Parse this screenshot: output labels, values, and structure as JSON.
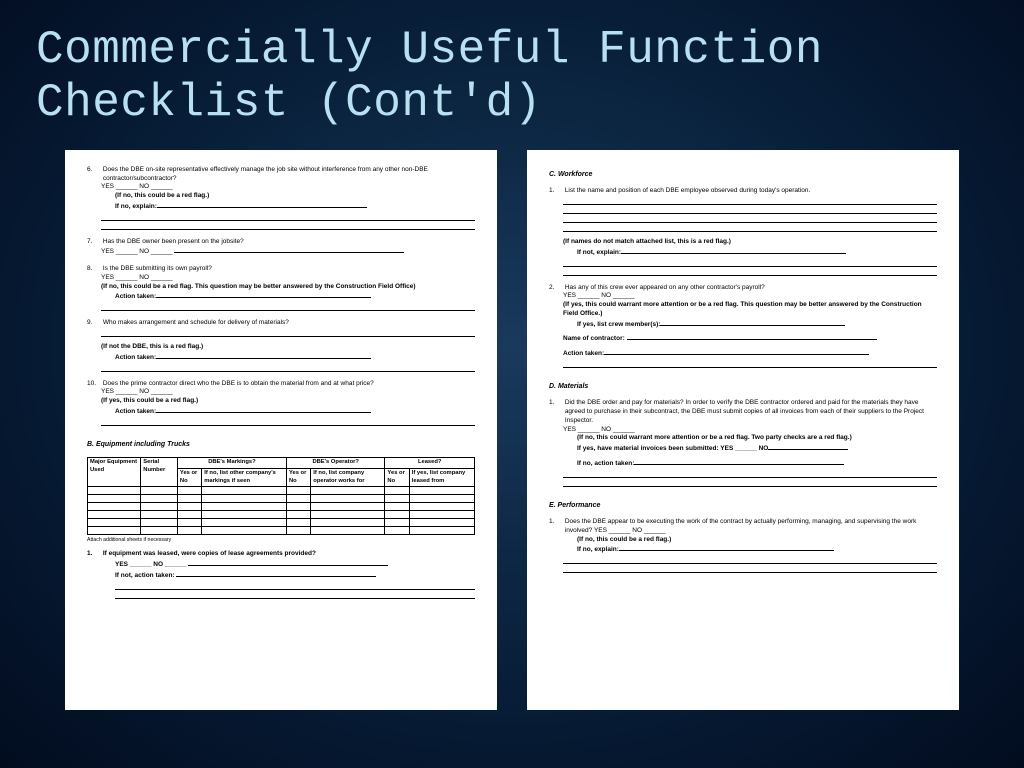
{
  "title": "Commercially Useful Function Checklist (Cont'd)",
  "left": {
    "q6": {
      "num": "6.",
      "text": "Does the DBE on-site representative effectively manage the job site without interference from any other non-DBE contractor/subcontractor?",
      "yn": "YES ______   NO ______",
      "flag": "(If no, this could be a red flag.)",
      "explain": "If no, explain:"
    },
    "q7": {
      "num": "7.",
      "text": "Has the DBE owner been present on the jobsite?",
      "yn": "YES ______   NO ______"
    },
    "q8": {
      "num": "8.",
      "text": "Is the DBE submitting its own payroll?",
      "yn": "YES ______   NO ______",
      "flag": "(If no, this could be a red flag.  This question may be better answered by the Construction Field Office)",
      "action": "Action taken:"
    },
    "q9": {
      "num": "9.",
      "text": "Who makes arrangement and schedule for delivery of materials?",
      "flag": "(If not the DBE, this is a red flag.)",
      "action": "Action taken:"
    },
    "q10": {
      "num": "10.",
      "text": "Does the prime contractor direct who the DBE is to obtain the material from and at what price?",
      "yn": "YES ______   NO ______",
      "flag": "(If yes, this could be a red flag.)",
      "action": "Action taken:"
    },
    "sectionB": "B. Equipment including Trucks",
    "equip_table": {
      "group_headers": [
        "",
        "",
        "DBE's Markings?",
        "DBE's Operator?",
        "Leased?"
      ],
      "col_headers": [
        "Major Equipment Used",
        "Serial Number",
        "Yes or No",
        "If no, list other company's markings if seen",
        "Yes or No",
        "If no, list company operator works for",
        "Yes or No",
        "If yes, list company leased from"
      ],
      "blank_rows": 6
    },
    "attach_note": "Attach additional sheets if necessary",
    "qB1": {
      "num": "1.",
      "text": "If equipment was leased, were copies of lease agreements provided?",
      "yn": "YES ______   NO ______",
      "action": "If not, action taken:"
    }
  },
  "right": {
    "sectionC": "C. Workforce",
    "qC1": {
      "num": "1.",
      "text": "List the name and position of each DBE employee observed during today's operation.",
      "flag": "(If names do not match attached list, this is a red flag.)",
      "explain": "If not, explain:"
    },
    "qC2": {
      "num": "2.",
      "text": "Has any of this crew ever appeared on any other contractor's payroll?",
      "yn": "YES ______   NO ______",
      "flag": "(If yes, this could warrant more attention or be a red flag.  This question may be better answered by the Construction Field Office.)",
      "crew": "If yes, list crew member(s):",
      "name_contr": "Name of contractor:",
      "action": "Action taken:"
    },
    "sectionD": "D. Materials",
    "qD1": {
      "num": "1.",
      "text": "Did the DBE order and pay for materials? In order to verify the DBE contractor ordered and paid for the materials they have agreed to purchase in their subcontract, the DBE must submit copies of all invoices from each of their suppliers to the Project Inspector.",
      "yn": "YES ______   NO ______",
      "flag": "(If no, this could warrant more attention or be a red flag.  Two party checks are a red flag.)",
      "invoices": "If yes, have material invoices been submitted:   YES  ______ NO",
      "action": "If no, action taken:"
    },
    "sectionE": "E. Performance",
    "qE1": {
      "num": "1.",
      "text": "Does the DBE appear to be executing the work of the contract by actually performing, managing, and supervising the work involved?  YES ______   NO ______",
      "flag": "(If no, this could be a red flag.)",
      "explain": "If no, explain:"
    }
  }
}
